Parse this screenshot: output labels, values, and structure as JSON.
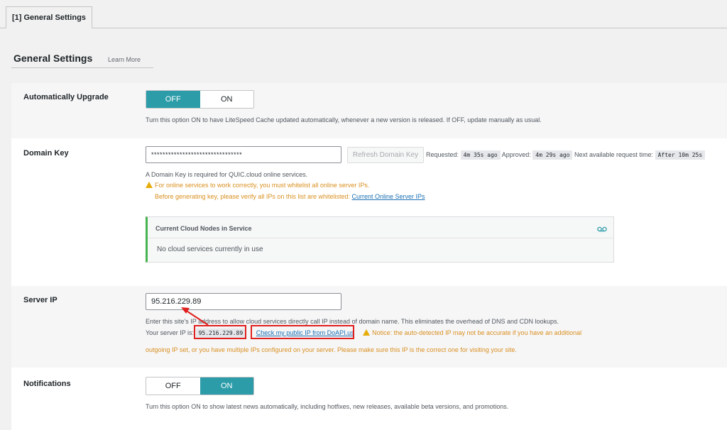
{
  "tab": {
    "label": "[1] General Settings"
  },
  "section": {
    "title": "General Settings",
    "learn_more": "Learn More"
  },
  "auto_upgrade": {
    "label": "Automatically Upgrade",
    "off": "OFF",
    "on": "ON",
    "selected": "OFF",
    "desc": "Turn this option ON to have LiteSpeed Cache updated automatically, whenever a new version is released. If OFF, update manually as usual."
  },
  "domain_key": {
    "label": "Domain Key",
    "value": "********************************",
    "refresh_button": "Refresh Domain Key",
    "requested_label": "Requested:",
    "requested_value": "4m 35s ago",
    "approved_label": "Approved:",
    "approved_value": "4m 29s ago",
    "next_label": "Next available request time:",
    "next_value": "After 10m 25s",
    "desc": "A Domain Key is required for QUIC.cloud online services.",
    "warn1": "For online services to work correctly, you must whitelist all online server IPs.",
    "warn2": "Before generating key, please verify all IPs on this list are whitelisted:",
    "warn2_link": "Current Online Server IPs",
    "cloud_title": "Current Cloud Nodes in Service",
    "cloud_text": "No cloud services currently in use"
  },
  "server_ip": {
    "label": "Server IP",
    "value": "95.216.229.89",
    "desc": "Enter this site's IP address to allow cloud services directly call IP instead of domain name. This eliminates the overhead of DNS and CDN lookups.",
    "your_ip_label": "Your server IP is:",
    "detected_ip": "95.216.229.89",
    "check_link": "Check my public IP from DoAPI.us",
    "notice1": "Notice: the auto-detected IP may not be accurate if you have an additional",
    "notice2": "outgoing IP set, or you have multiple IPs configured on your server. Please make sure this IP is the correct one for visiting your site."
  },
  "notifications": {
    "label": "Notifications",
    "off": "OFF",
    "on": "ON",
    "selected": "ON",
    "desc": "Turn this option ON to show latest news automatically, including hotfixes, new releases, available beta versions, and promotions."
  },
  "colors": {
    "accent": "#2b9ca8",
    "warning": "#d98f1f",
    "highlight": "#e0201e"
  }
}
